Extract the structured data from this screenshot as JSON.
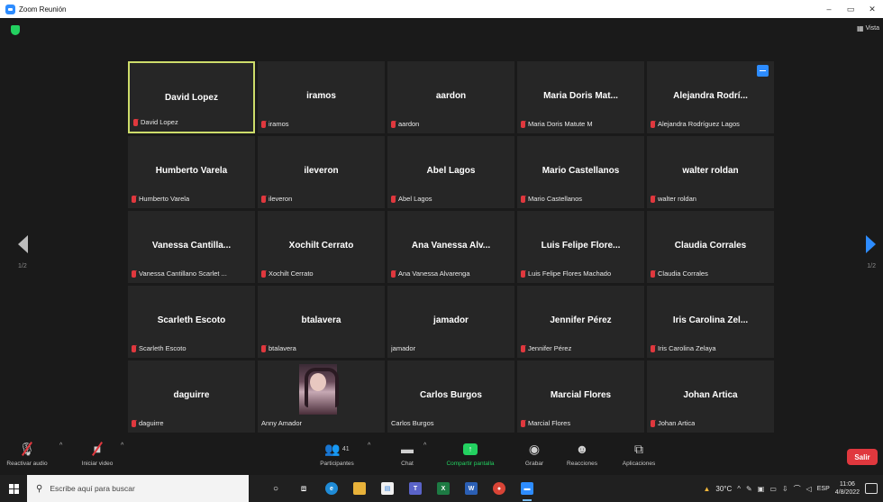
{
  "window": {
    "title": "Zoom Reunión",
    "controls": [
      "–",
      "▭",
      "✕"
    ]
  },
  "meeting": {
    "view_label": "Vista",
    "page_left": "1/2",
    "page_right": "1/2",
    "tiles": [
      {
        "name": "David Lopez",
        "label": "David Lopez",
        "muted": true
      },
      {
        "name": "iramos",
        "label": "iramos",
        "muted": true
      },
      {
        "name": "aardon",
        "label": "aardon",
        "muted": true,
        "active": true
      },
      {
        "name": "Maria Doris Mat...",
        "label": "Maria Doris Matute M",
        "muted": true
      },
      {
        "name": "Alejandra Rodrí...",
        "label": "Alejandra Rodríguez Lagos",
        "muted": true,
        "hand_badge": true
      },
      {
        "name": "Humberto Varela",
        "label": "Humberto Varela",
        "muted": true
      },
      {
        "name": "ileveron",
        "label": "ileveron",
        "muted": true
      },
      {
        "name": "Abel Lagos",
        "label": "Abel Lagos",
        "muted": true
      },
      {
        "name": "Mario Castellanos",
        "label": "Mario Castellanos",
        "muted": true
      },
      {
        "name": "walter roldan",
        "label": "walter roldan",
        "muted": true
      },
      {
        "name": "Vanessa Cantilla...",
        "label": "Vanessa Cantillano Scarlet ...",
        "muted": true
      },
      {
        "name": "Xochilt Cerrato",
        "label": "Xochilt Cerrato",
        "muted": true
      },
      {
        "name": "Ana Vanessa Alv...",
        "label": "Ana Vanessa Alvarenga",
        "muted": true
      },
      {
        "name": "Luis Felipe Flore...",
        "label": "Luis Felipe Flores Machado",
        "muted": true
      },
      {
        "name": "Claudia Corrales",
        "label": "Claudia Corrales",
        "muted": true
      },
      {
        "name": "Scarleth Escoto",
        "label": "Scarleth Escoto",
        "muted": true
      },
      {
        "name": "btalavera",
        "label": "btalavera",
        "muted": true
      },
      {
        "name": "jamador",
        "label": "jamador",
        "muted": false
      },
      {
        "name": "Jennifer Pérez",
        "label": "Jennifer Pérez",
        "muted": true
      },
      {
        "name": "Iris Carolina Zel...",
        "label": "Iris Carolina Zelaya",
        "muted": true
      },
      {
        "name": "daguirre",
        "label": "daguirre",
        "muted": true
      },
      {
        "name": "",
        "label": "Anny Amador",
        "muted": false,
        "photo": true
      },
      {
        "name": "Carlos Burgos",
        "label": "Carlos Burgos",
        "muted": false
      },
      {
        "name": "Marcial Flores",
        "label": "Marcial Flores",
        "muted": true
      },
      {
        "name": "Johan Artica",
        "label": "Johan Artica",
        "muted": true
      }
    ]
  },
  "controls": {
    "audio_label": "Reactivar audio",
    "video_label": "Iniciar video",
    "participants_label": "Participantes",
    "participants_count": "41",
    "chat_label": "Chat",
    "share_label": "Compartir pantalla",
    "record_label": "Grabar",
    "reactions_label": "Reacciones",
    "apps_label": "Aplicaciones",
    "leave_label": "Salir"
  },
  "taskbar": {
    "search_placeholder": "Escribe aquí para buscar",
    "temperature": "30°C",
    "language": "ESP",
    "time": "11:06",
    "date": "4/8/2022"
  },
  "colors": {
    "accent": "#2d8cff",
    "active_speaker": "#cddc6a",
    "muted": "#e0383e",
    "share": "#23d160"
  }
}
